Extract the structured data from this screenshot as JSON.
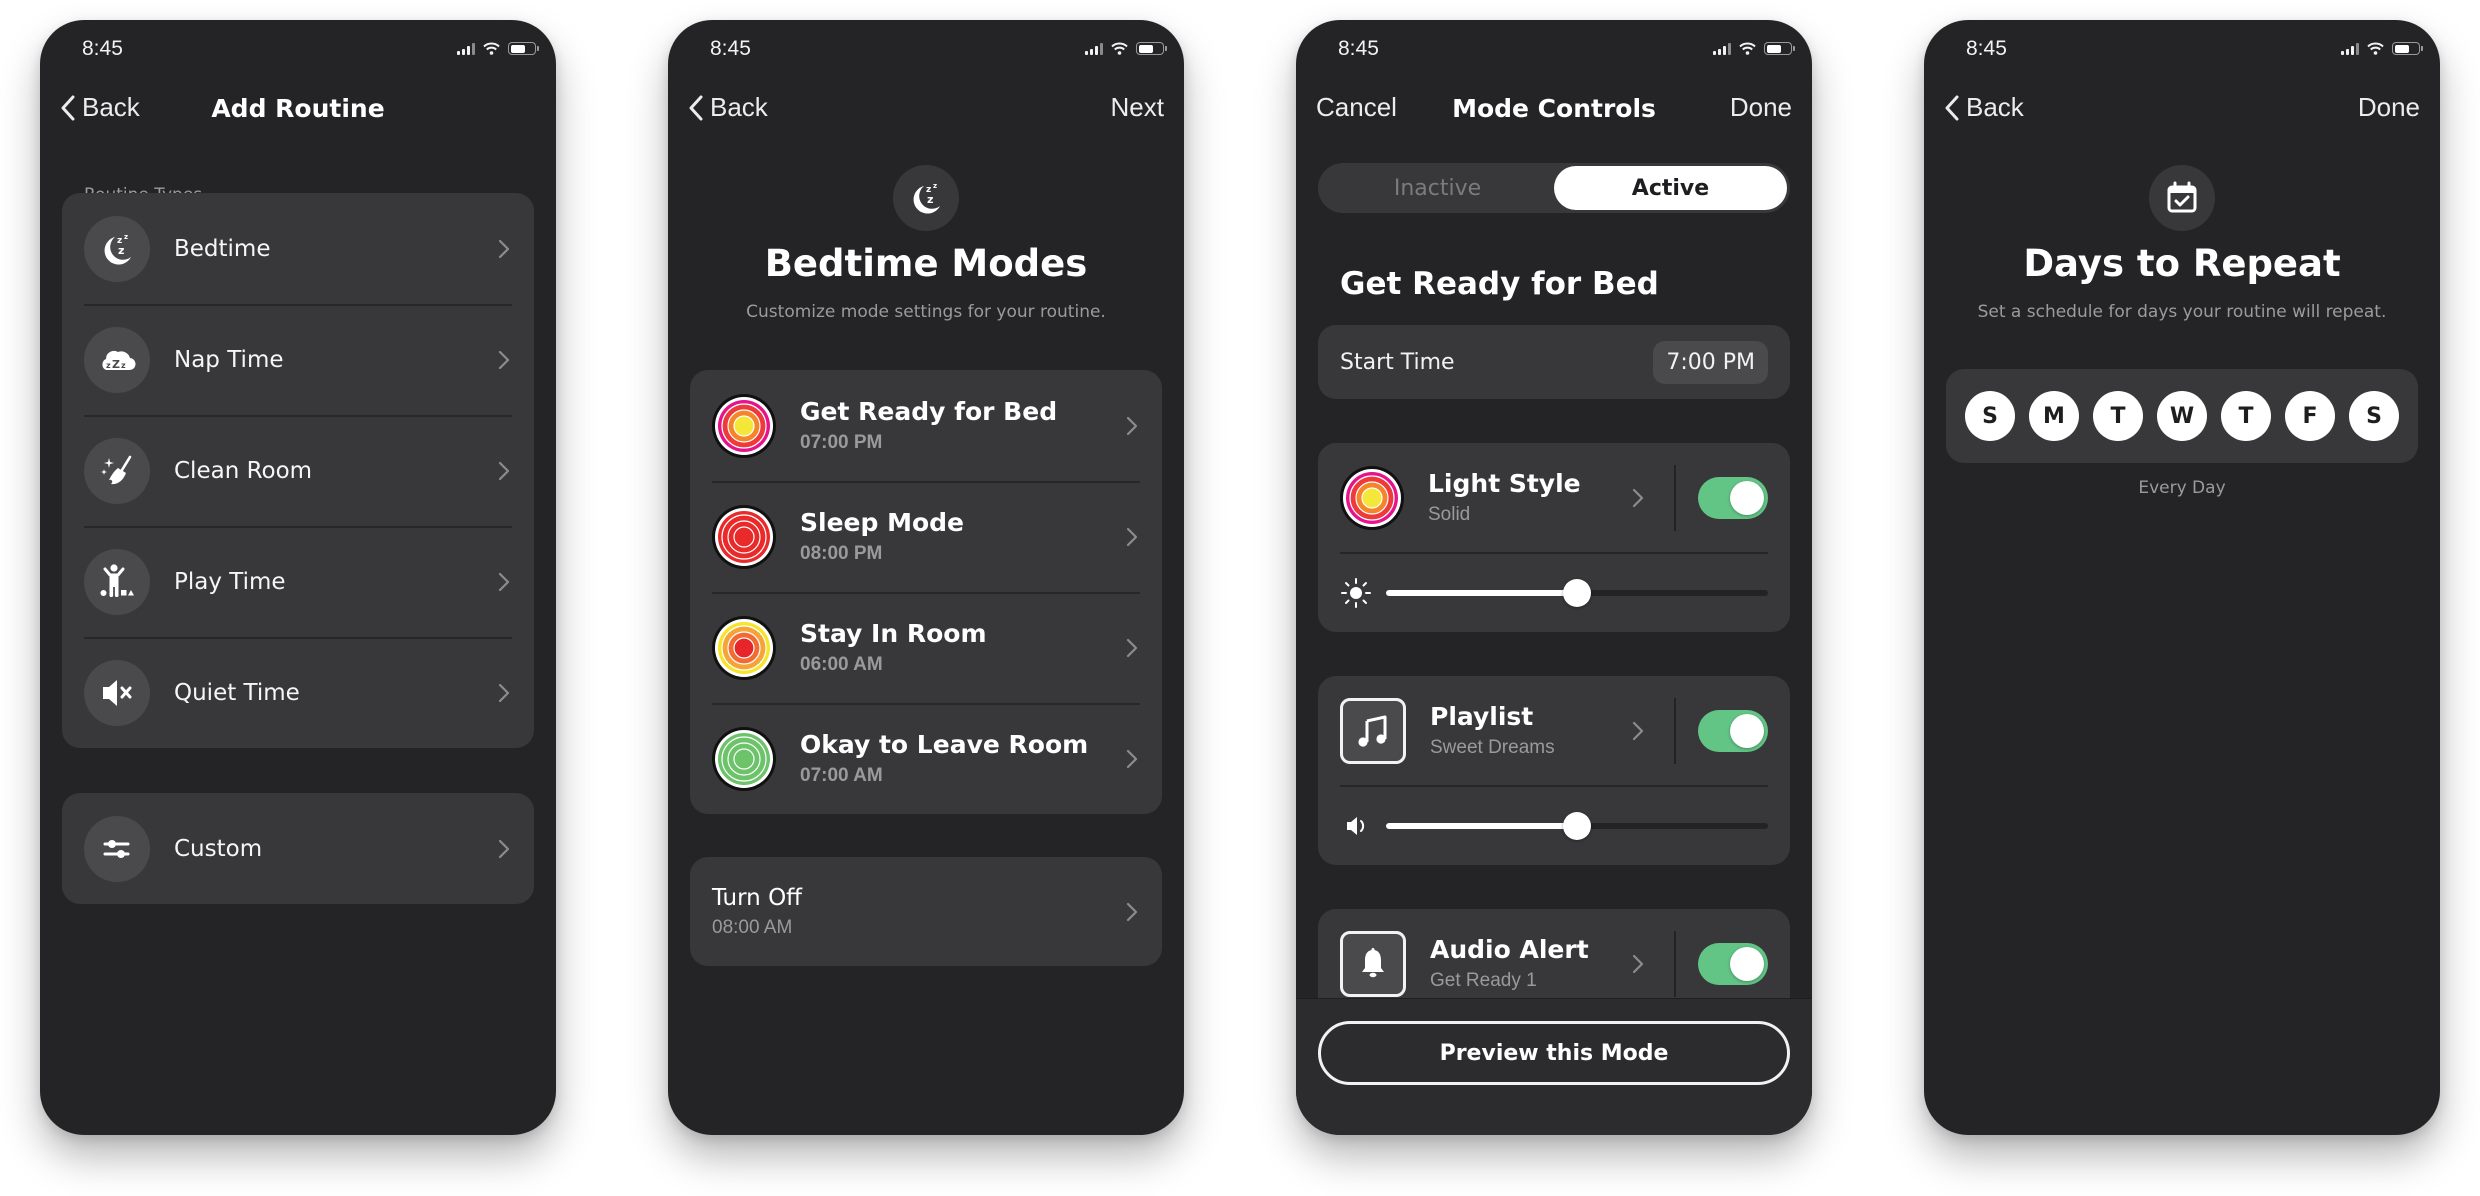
{
  "status_bar": {
    "time": "8:45"
  },
  "screens": {
    "add_routine": {
      "nav": {
        "back": "Back",
        "title": "Add Routine"
      },
      "section_label": "Routine Types",
      "routine_types": [
        {
          "label": "Bedtime",
          "icon": "moon-zzz-icon"
        },
        {
          "label": "Nap Time",
          "icon": "cloud-zzz-icon"
        },
        {
          "label": "Clean Room",
          "icon": "broom-sparkle-icon"
        },
        {
          "label": "Play Time",
          "icon": "child-playing-icon"
        },
        {
          "label": "Quiet Time",
          "icon": "speaker-mute-icon"
        }
      ],
      "custom": {
        "label": "Custom",
        "icon": "sliders-icon"
      }
    },
    "bedtime_modes": {
      "nav": {
        "back": "Back",
        "next": "Next"
      },
      "title": "Bedtime Modes",
      "subtitle": "Customize mode settings for your routine.",
      "modes": [
        {
          "name": "Get Ready for Bed",
          "time": "07:00 PM",
          "colors": [
            "#e6148a",
            "#ee3a3a",
            "#f5842a",
            "#f5e63a"
          ]
        },
        {
          "name": "Sleep Mode",
          "time": "08:00 PM",
          "colors": [
            "#e92a2a",
            "#e92a2a",
            "#e92a2a",
            "#e92a2a"
          ]
        },
        {
          "name": "Stay In Room",
          "time": "06:00 AM",
          "colors": [
            "#f7e52b",
            "#f5a43a",
            "#f26b33",
            "#e6262a"
          ]
        },
        {
          "name": "Okay to Leave Room",
          "time": "07:00 AM",
          "colors": [
            "#6cc36a",
            "#6cc36a",
            "#6cc36a",
            "#6cc36a"
          ]
        }
      ],
      "turn_off": {
        "label": "Turn Off",
        "time": "08:00 AM"
      }
    },
    "mode_controls": {
      "nav": {
        "cancel": "Cancel",
        "title": "Mode Controls",
        "done": "Done"
      },
      "segment": {
        "options": [
          "Inactive",
          "Active"
        ],
        "selected": "Active"
      },
      "mode_name": "Get Ready for Bed",
      "start_time": {
        "label": "Start Time",
        "value": "7:00 PM"
      },
      "light_style": {
        "title": "Light Style",
        "value": "Solid",
        "enabled": true,
        "brightness_percent": 50
      },
      "playlist": {
        "title": "Playlist",
        "value": "Sweet Dreams",
        "enabled": true,
        "volume_percent": 50
      },
      "audio_alert": {
        "title": "Audio Alert",
        "value": "Get Ready 1",
        "enabled": true
      },
      "preview_button": "Preview this Mode"
    },
    "days_to_repeat": {
      "nav": {
        "back": "Back",
        "done": "Done"
      },
      "title": "Days to Repeat",
      "subtitle": "Set a schedule for days your routine will repeat.",
      "days": [
        "S",
        "M",
        "T",
        "W",
        "T",
        "F",
        "S"
      ],
      "summary": "Every Day"
    }
  },
  "colors": {
    "toggle_on": "#62c586",
    "background": "#242426",
    "card": "#38383b"
  }
}
